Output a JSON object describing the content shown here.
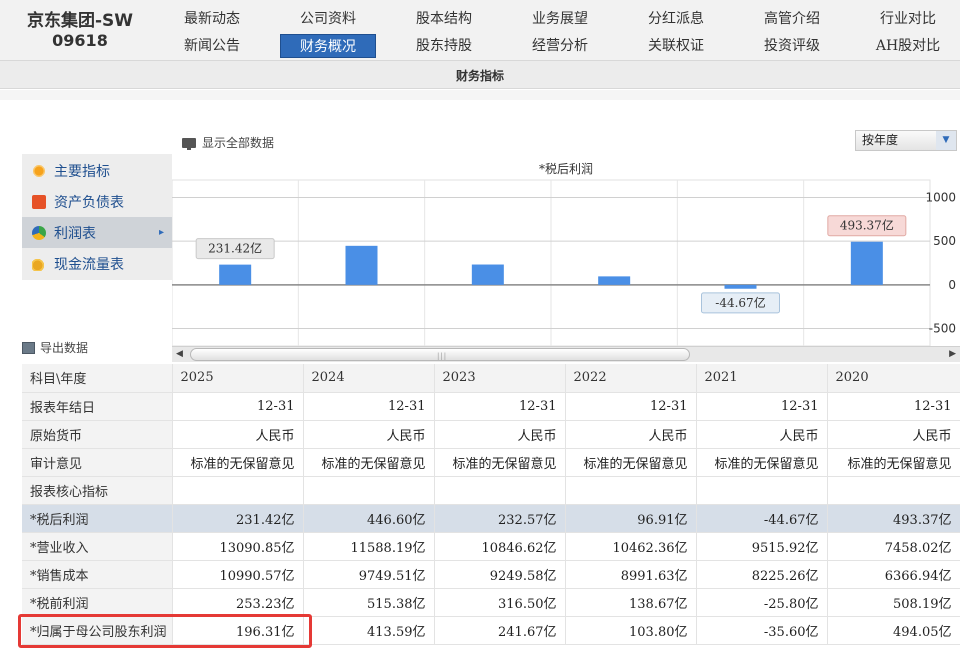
{
  "stock": {
    "name": "京东集团-SW",
    "code": "09618"
  },
  "nav": {
    "row1": [
      "最新动态",
      "公司资料",
      "股本结构",
      "业务展望",
      "分红派息",
      "高管介绍",
      "行业对比"
    ],
    "row2": [
      "新闻公告",
      "财务概况",
      "股东持股",
      "经营分析",
      "关联权证",
      "投资评级",
      "AH股对比"
    ],
    "active": "财务概况"
  },
  "subnav": {
    "title": "财务指标"
  },
  "toolbar": {
    "show_all": "显示全部数据",
    "period_select": "按年度"
  },
  "sidebar": {
    "items": [
      {
        "label": "主要指标",
        "icon": "sun-icon"
      },
      {
        "label": "资产负债表",
        "icon": "document-icon"
      },
      {
        "label": "利润表",
        "icon": "pie-chart-icon",
        "active": true
      },
      {
        "label": "现金流量表",
        "icon": "coins-icon"
      }
    ]
  },
  "export_label": "导出数据",
  "colors": {
    "bar": "#4a8fe6",
    "accent": "#2f6bb9",
    "highlight_row": "#d6dee8",
    "annotation_box": "#e53935",
    "neg_label_bg": "#e6eef6",
    "pos_label_bg": "#f7d9d7"
  },
  "chart_data": {
    "type": "bar",
    "title": "*税后利润",
    "categories": [
      "2025",
      "2024",
      "2023",
      "2022",
      "2021",
      "2020"
    ],
    "values": [
      231.42,
      446.6,
      232.57,
      96.91,
      -44.67,
      493.37
    ],
    "data_labels": [
      "231.42亿",
      "",
      "",
      "",
      "-44.67亿",
      "493.37亿"
    ],
    "y_ticks": [
      1000,
      500,
      0,
      -500
    ],
    "ylim": [
      -700,
      1200
    ],
    "grid": true
  },
  "table": {
    "header": [
      "科目\\年度",
      "2025",
      "2024",
      "2023",
      "2022",
      "2021",
      "2020"
    ],
    "rows": [
      {
        "label": "报表年结日",
        "values": [
          "12-31",
          "12-31",
          "12-31",
          "12-31",
          "12-31",
          "12-31"
        ]
      },
      {
        "label": "原始货币",
        "values": [
          "人民币",
          "人民币",
          "人民币",
          "人民币",
          "人民币",
          "人民币"
        ]
      },
      {
        "label": "审计意见",
        "values": [
          "标准的无保留意见",
          "标准的无保留意见",
          "标准的无保留意见",
          "标准的无保留意见",
          "标准的无保留意见",
          "标准的无保留意见"
        ]
      },
      {
        "label": "报表核心指标",
        "values": [
          "",
          "",
          "",
          "",
          "",
          ""
        ],
        "section": true
      },
      {
        "label": "*税后利润",
        "values": [
          "231.42亿",
          "446.60亿",
          "232.57亿",
          "96.91亿",
          "-44.67亿",
          "493.37亿"
        ],
        "highlight": true
      },
      {
        "label": "*营业收入",
        "values": [
          "13090.85亿",
          "11588.19亿",
          "10846.62亿",
          "10462.36亿",
          "9515.92亿",
          "7458.02亿"
        ]
      },
      {
        "label": "*销售成本",
        "values": [
          "10990.57亿",
          "9749.51亿",
          "9249.58亿",
          "8991.63亿",
          "8225.26亿",
          "6366.94亿"
        ]
      },
      {
        "label": "*税前利润",
        "values": [
          "253.23亿",
          "515.38亿",
          "316.50亿",
          "138.67亿",
          "-25.80亿",
          "508.19亿"
        ]
      },
      {
        "label": "*归属于母公司股东利润",
        "values": [
          "196.31亿",
          "413.59亿",
          "241.67亿",
          "103.80亿",
          "-35.60亿",
          "494.05亿"
        ]
      }
    ]
  }
}
